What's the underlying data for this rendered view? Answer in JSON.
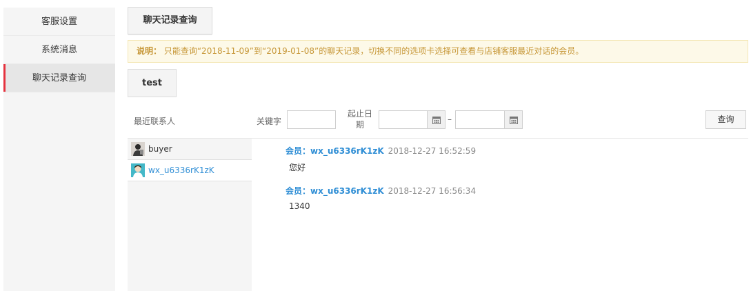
{
  "sidebar": {
    "items": [
      {
        "label": "客服设置"
      },
      {
        "label": "系统消息"
      },
      {
        "label": "聊天记录查询"
      }
    ]
  },
  "main_tab": {
    "label": "聊天记录查询"
  },
  "notice": {
    "prefix": "说明：",
    "text": "只能查询“2018-11-09”到“2019-01-08”的聊天记录，切换不同的选项卡选择可查看与店铺客服最近对话的会员。"
  },
  "store_tab": {
    "label": "test"
  },
  "filter": {
    "recent_label": "最近联系人",
    "keyword_label": "关键字",
    "keyword_value": "",
    "date_label": "起止日期",
    "date_start": "",
    "date_end": "",
    "separator": "–",
    "query_label": "查询"
  },
  "contacts": [
    {
      "name": "buyer"
    },
    {
      "name": "wx_u6336rK1zK"
    }
  ],
  "messages": [
    {
      "sender": "会员：wx_u6336rK1zK",
      "time": "2018-12-27 16:52:59",
      "body": "您好"
    },
    {
      "sender": "会员：wx_u6336rK1zK",
      "time": "2018-12-27 16:56:34",
      "body": "1340"
    }
  ],
  "colors": {
    "accent": "#e5323e",
    "link": "#2f8ed5",
    "notice_text": "#c69636",
    "notice_bg": "#fdf9e8"
  }
}
